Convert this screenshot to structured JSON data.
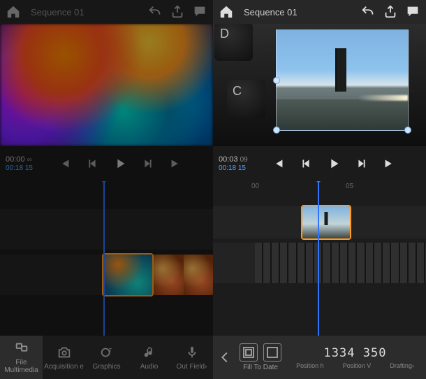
{
  "left": {
    "title": "Sequence 01",
    "time_main": "00:00",
    "time_inf": "∞",
    "time_sub": "00:18",
    "time_sub2": "15",
    "tabs": {
      "multimedia": "File\nMultimedia",
      "acquisition": "Acquisition e",
      "graphics": "Graphics",
      "audio": "Audio",
      "out": "Out Field›"
    }
  },
  "right": {
    "title": "Sequence 01",
    "time_main": "00:03",
    "time_frames": "09",
    "time_sub": "00:18",
    "time_sub2": "15",
    "ruler": {
      "t0": "00",
      "t1": "05"
    },
    "fill_label": "Fill To Date",
    "nums": "1334 350",
    "sublabels": [
      "Position h",
      "Position V",
      "Drafting›"
    ]
  }
}
